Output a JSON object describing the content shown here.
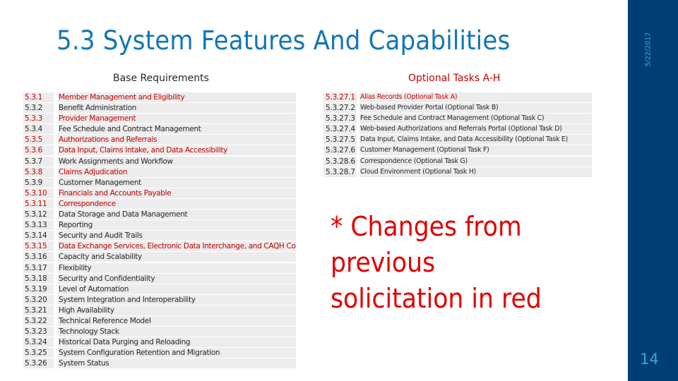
{
  "slide": {
    "title": "5.3  System Features And Capabilities",
    "date": "5/22/2017",
    "page_number": "14"
  },
  "colors": {
    "title": "#1276b5",
    "changed_text": "#c00000",
    "note_text": "#e00000",
    "sidebar": "#003f73",
    "row_background": "#ececec"
  },
  "base": {
    "heading": "Base Requirements",
    "rows": [
      {
        "num": "5.3.1",
        "desc": "Member Management and Eligibility",
        "changed": true
      },
      {
        "num": "5.3.2",
        "desc": "Benefit Administration",
        "changed": false
      },
      {
        "num": "5.3.3",
        "desc": "Provider Management",
        "changed": true
      },
      {
        "num": "5.3.4",
        "desc": "Fee Schedule and Contract Management",
        "changed": false
      },
      {
        "num": "5.3.5",
        "desc": "Authorizations and Referrals",
        "changed": true
      },
      {
        "num": "5.3.6",
        "desc": "Data Input, Claims Intake, and Data Accessibility",
        "changed": true
      },
      {
        "num": "5.3.7",
        "desc": "Work Assignments and Workflow",
        "changed": false
      },
      {
        "num": "5.3.8",
        "desc": "Claims Adjudication",
        "changed": true
      },
      {
        "num": "5.3.9",
        "desc": "Customer Management",
        "changed": false
      },
      {
        "num": "5.3.10",
        "desc": "Financials and Accounts Payable",
        "changed": true
      },
      {
        "num": "5.3.11",
        "desc": "Correspondence",
        "changed": true
      },
      {
        "num": "5.3.12",
        "desc": "Data Storage and Data Management",
        "changed": false
      },
      {
        "num": "5.3.13",
        "desc": "Reporting",
        "changed": false
      },
      {
        "num": "5.3.14",
        "desc": "Security and Audit Trails",
        "changed": false
      },
      {
        "num": "5.3.15",
        "desc": "Data Exchange Services, Electronic Data Interchange, and CAQH Core",
        "changed": true
      },
      {
        "num": "5.3.16",
        "desc": "Capacity and Scalability",
        "changed": false
      },
      {
        "num": "5.3.17",
        "desc": "Flexibility",
        "changed": false
      },
      {
        "num": "5.3.18",
        "desc": "Security and Confidentiality",
        "changed": false
      },
      {
        "num": "5.3.19",
        "desc": "Level of Automation",
        "changed": false
      },
      {
        "num": "5.3.20",
        "desc": "System Integration and Interoperability",
        "changed": false
      },
      {
        "num": "5.3.21",
        "desc": "High Availability",
        "changed": false
      },
      {
        "num": "5.3.22",
        "desc": "Technical Reference Model",
        "changed": false
      },
      {
        "num": "5.3.23",
        "desc": "Technology Stack",
        "changed": false
      },
      {
        "num": "5.3.24",
        "desc": "Historical Data Purging and Reloading",
        "changed": false
      },
      {
        "num": "5.3.25",
        "desc": "System Configuration Retention and Migration",
        "changed": false
      },
      {
        "num": "5.3.26",
        "desc": "System Status",
        "changed": false
      }
    ]
  },
  "optional": {
    "heading": "Optional Tasks A-H",
    "rows": [
      {
        "num": "5.3.27.1",
        "desc": "Alias Records (Optional Task A)",
        "changed": true
      },
      {
        "num": "5.3.27.2",
        "desc": "Web-based Provider Portal (Optional Task B)",
        "changed": false
      },
      {
        "num": "5.3.27.3",
        "desc": "Fee Schedule and Contract Management (Optional Task C)",
        "changed": false
      },
      {
        "num": "5.3.27.4",
        "desc": "Web-based Authorizations and Referrals Portal (Optional Task D)",
        "changed": false
      },
      {
        "num": "5.3.27.5",
        "desc": "Data Input, Claims Intake, and Data Accessibility (Optional Task E)",
        "changed": false
      },
      {
        "num": "5.3.27.6",
        "desc": "Customer Management (Optional Task F)",
        "changed": false
      },
      {
        "num": "5.3.28.6",
        "desc": "Correspondence (Optional Task G)",
        "changed": false
      },
      {
        "num": "5.3.28.7",
        "desc": "Cloud Environment (Optional Task H)",
        "changed": false
      }
    ]
  },
  "note": "* Changes from previous solicitation in red"
}
